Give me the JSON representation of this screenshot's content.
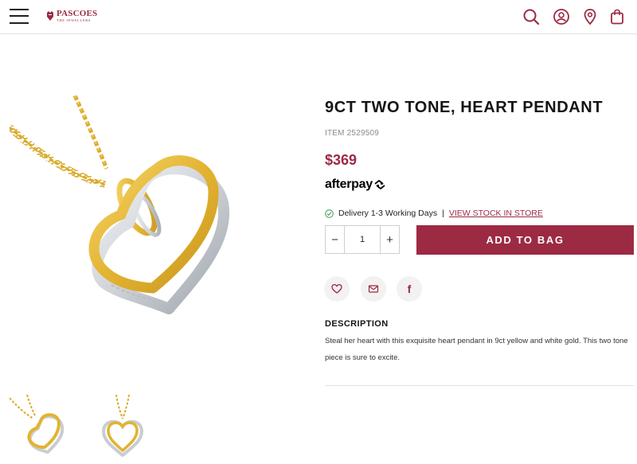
{
  "header": {
    "logo_name": "PASCOES",
    "logo_sub": "THE JEWELLERS",
    "icons": [
      "menu-icon",
      "search-icon",
      "account-icon",
      "store-locator-icon",
      "bag-icon"
    ]
  },
  "product": {
    "title": "9CT TWO TONE, HEART PENDANT",
    "item_number": "ITEM 2529509",
    "price": "$369",
    "afterpay": "afterpay"
  },
  "delivery": {
    "text": "Delivery 1-3 Working Days",
    "separator": "|",
    "stock_link": "VIEW STOCK IN STORE"
  },
  "quantity": {
    "decrement": "−",
    "value": "1",
    "increment": "+"
  },
  "add_to_bag": "ADD TO BAG",
  "actions": [
    "wishlist-heart-icon",
    "email-icon",
    "facebook-icon"
  ],
  "actions_facebook_glyph": "f",
  "description": {
    "heading": "DESCRIPTION",
    "body": "Steal her heart with this exquisite heart pendant in 9ct yellow and white gold. This two tone piece is sure to excite."
  },
  "colors": {
    "brand": "#9c2a43",
    "gold": "#e2b53a",
    "white_gold": "#d6d9dd"
  }
}
